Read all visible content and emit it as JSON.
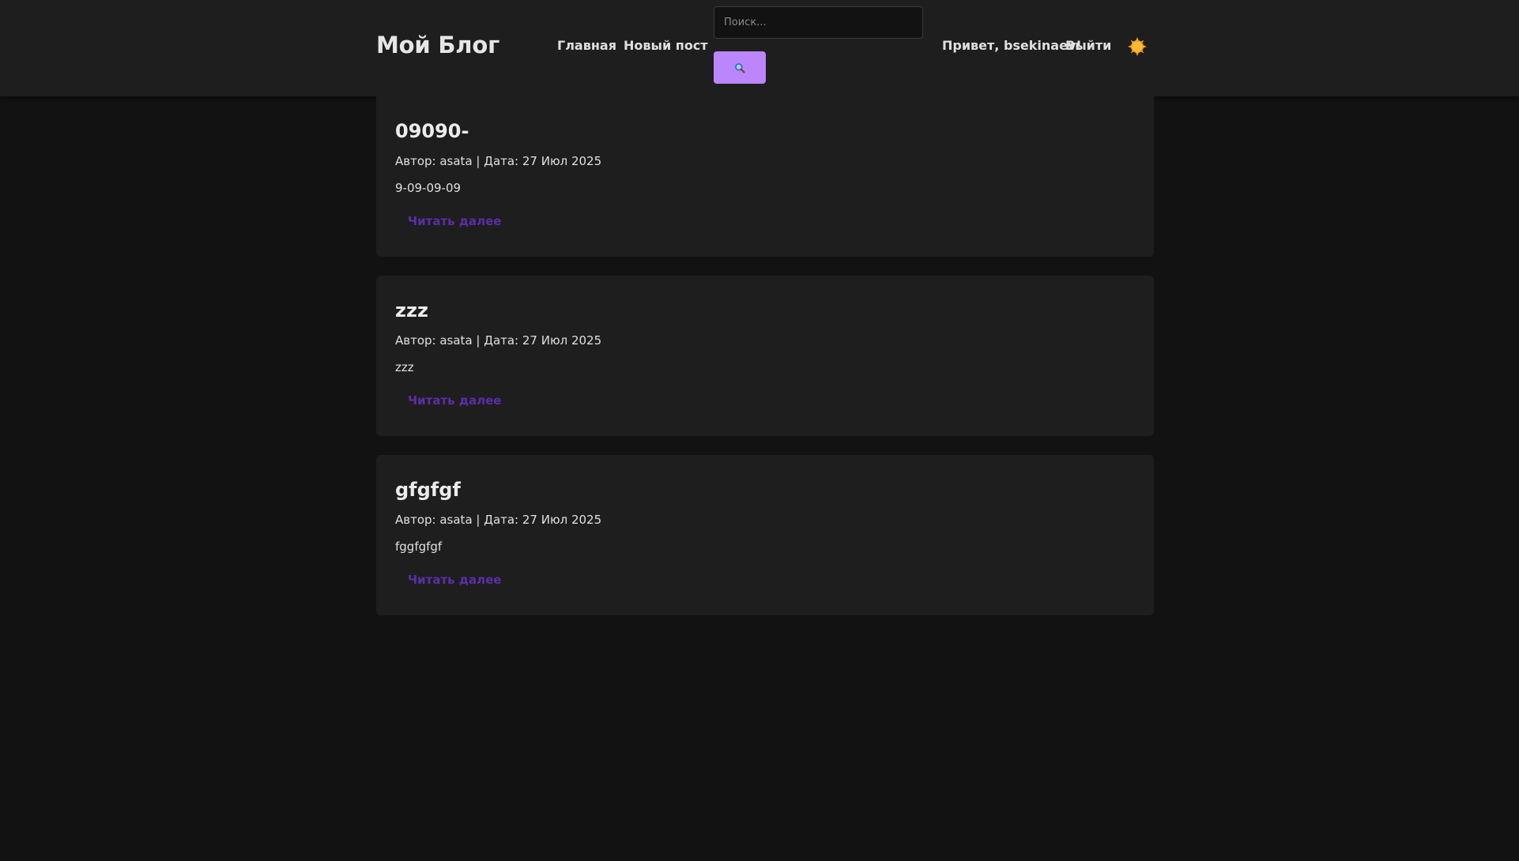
{
  "header": {
    "logo": "Мой Блог",
    "nav": {
      "home": "Главная",
      "new_post": "Новый пост"
    },
    "search": {
      "placeholder": "Поиск...",
      "button_icon": "magnifier-icon"
    },
    "greeting": "Привет, bsekinaev!",
    "logout": "Выйти",
    "theme_toggle_icon": "sun-icon"
  },
  "posts": [
    {
      "title": "09090-",
      "meta": "Автор: asata | Дата: 27 Июл 2025",
      "excerpt": "9-09-09-09",
      "read_more": "Читать далее"
    },
    {
      "title": "zzz",
      "meta": "Автор: asata | Дата: 27 Июл 2025",
      "excerpt": "zzz",
      "read_more": "Читать далее"
    },
    {
      "title": "gfgfgf",
      "meta": "Автор: asata | Дата: 27 Июл 2025",
      "excerpt": "fggfgfgf",
      "read_more": "Читать далее"
    }
  ],
  "colors": {
    "background": "#121212",
    "surface": "#1e1e1e",
    "accent": "#bb86fc",
    "link": "#5b2ea8",
    "sun": "#f5a623"
  }
}
